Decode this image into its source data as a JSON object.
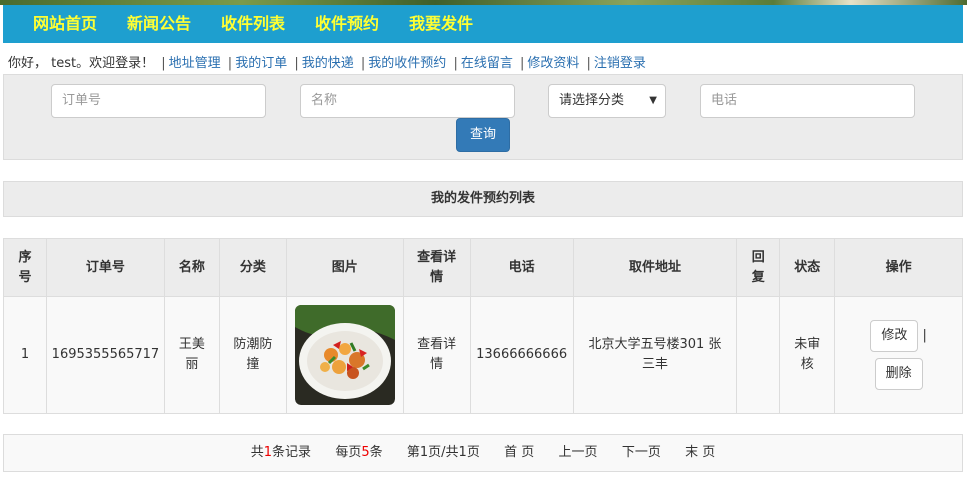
{
  "nav": {
    "items": [
      {
        "label": "网站首页"
      },
      {
        "label": "新闻公告"
      },
      {
        "label": "收件列表"
      },
      {
        "label": "收件预约"
      },
      {
        "label": "我要发件"
      }
    ]
  },
  "welcome": {
    "greeting": "你好，  test。欢迎登录！",
    "links": [
      "地址管理",
      "我的订单",
      "我的快递",
      "我的收件预约",
      "在线留言",
      "修改资料",
      "注销登录"
    ]
  },
  "search": {
    "order_placeholder": "订单号",
    "name_placeholder": "名称",
    "category_selected": "请选择分类",
    "phone_placeholder": "电话",
    "query_label": "查询"
  },
  "list": {
    "title": "我的发件预约列表",
    "headers": [
      "序号",
      "订单号",
      "名称",
      "分类",
      "图片",
      "查看详情",
      "电话",
      "取件地址",
      "回复",
      "状态",
      "操作"
    ],
    "rows": [
      {
        "index": "1",
        "order_no": "1695355565717",
        "name": "王美丽",
        "category": "防潮防撞",
        "detail": "查看详情",
        "phone": "13666666666",
        "address": "北京大学五号楼301 张三丰",
        "reply": "",
        "status": "未审核",
        "edit_label": "修改",
        "op_sep": "|",
        "delete_label": "删除"
      }
    ]
  },
  "pager": {
    "total_prefix": "共",
    "total_count": "1",
    "total_suffix": "条记录",
    "per_page_prefix": "每页",
    "per_page_count": "5",
    "per_page_suffix": "条",
    "page_info": "第1页/共1页",
    "first": "首 页",
    "prev": "上一页",
    "next": "下一页",
    "last": "末 页"
  },
  "colors": {
    "nav_bg": "#1e9fcf",
    "nav_text": "#ffff33",
    "link": "#2a6fb0",
    "primary_button": "#337ab7",
    "highlight": "#ee0000"
  }
}
